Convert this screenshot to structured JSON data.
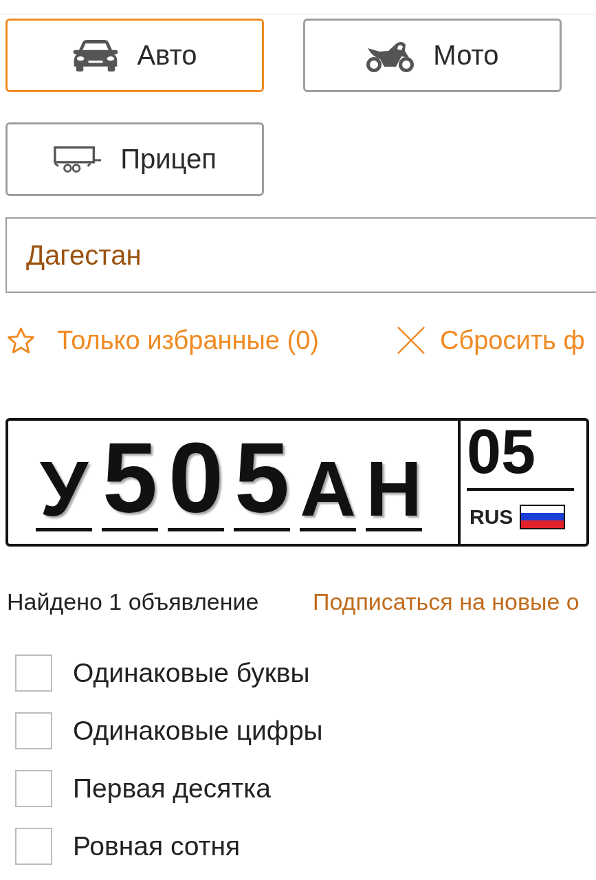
{
  "vehicle_types": [
    {
      "kind": "car",
      "label": "Авто",
      "selected": true
    },
    {
      "kind": "moto",
      "label": "Мото",
      "selected": false
    },
    {
      "kind": "trailer",
      "label": "Прицеп",
      "selected": false
    }
  ],
  "region_field": {
    "value": "Дагестан"
  },
  "actions": [
    {
      "kind": "favorites",
      "label": "Только избранные (0)"
    },
    {
      "kind": "reset",
      "label": "Сбросить ф"
    }
  ],
  "plate": {
    "characters": [
      {
        "kind": "letter",
        "value": "У"
      },
      {
        "kind": "digit",
        "value": "5"
      },
      {
        "kind": "digit",
        "value": "0"
      },
      {
        "kind": "digit",
        "value": "5"
      },
      {
        "kind": "letter",
        "value": "А"
      },
      {
        "kind": "letter",
        "value": "Н"
      }
    ],
    "region": "05",
    "country": "RUS"
  },
  "results": {
    "count": "Найдено 1 объявление",
    "subscribe_link": "Подписаться на новые о"
  },
  "filters": [
    {
      "label": "Одинаковые буквы",
      "checked": false
    },
    {
      "label": "Одинаковые цифры",
      "checked": false
    },
    {
      "label": "Первая десятка",
      "checked": false
    },
    {
      "label": "Ровная сотня",
      "checked": false
    }
  ]
}
